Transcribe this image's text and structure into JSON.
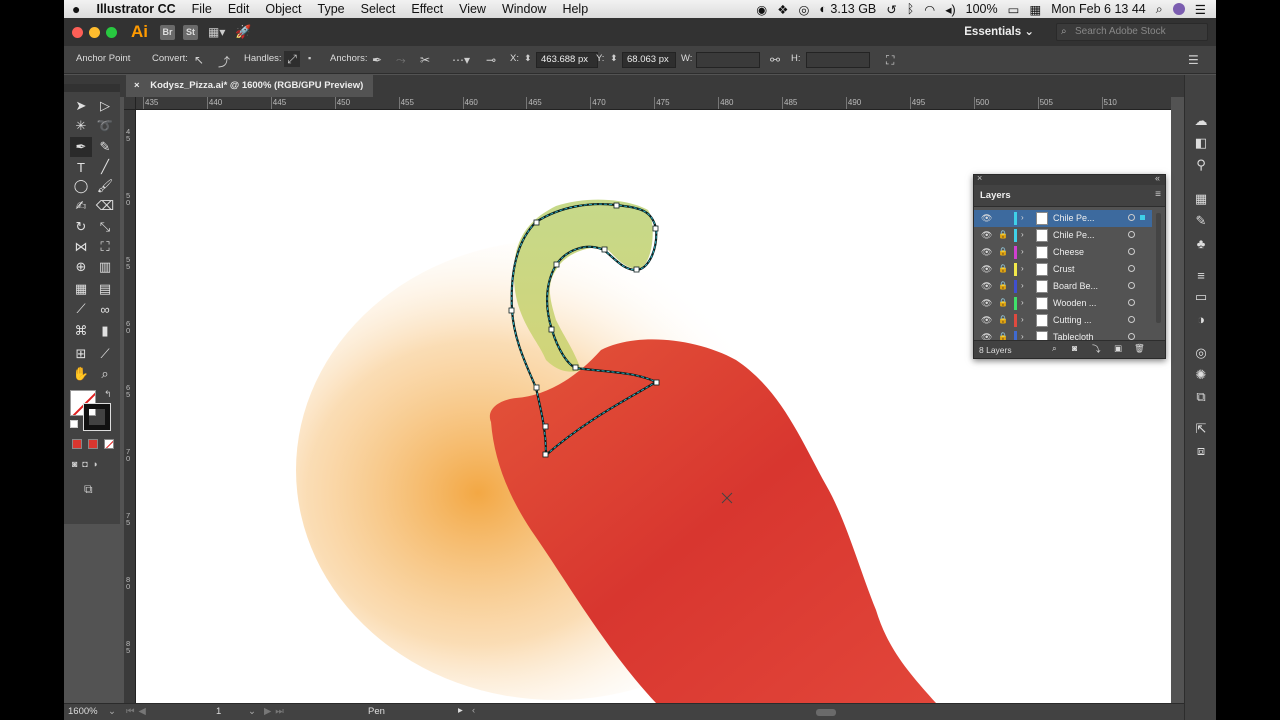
{
  "menubar": {
    "apple": "",
    "app_name": "Illustrator CC",
    "items": [
      "File",
      "Edit",
      "Object",
      "Type",
      "Select",
      "Effect",
      "View",
      "Window",
      "Help"
    ],
    "memory": "3.13 GB",
    "battery": "100%",
    "clock": "Mon Feb 6  13 44"
  },
  "titlebar": {
    "logo": "Ai",
    "bridge": "Br",
    "stock": "St",
    "workspace": "Essentials",
    "search_placeholder": "Search Adobe Stock"
  },
  "control": {
    "context_label": "Anchor Point",
    "convert_label": "Convert:",
    "handles_label": "Handles:",
    "anchors_label": "Anchors:",
    "x_label": "X:",
    "x_value": "463.688 px",
    "y_label": "Y:",
    "y_value": "68.063 px",
    "w_label": "W:",
    "h_label": "H:"
  },
  "document": {
    "tab_title": "Kodysz_Pizza.ai* @ 1600% (RGB/GPU Preview)",
    "close_glyph": "×"
  },
  "ruler": {
    "h_labels": [
      "435",
      "440",
      "445",
      "450",
      "455",
      "460",
      "465",
      "470",
      "475",
      "480",
      "485",
      "490",
      "495",
      "500",
      "505",
      "510"
    ],
    "v_labels": [
      "45",
      "50",
      "55",
      "60",
      "65",
      "70",
      "75",
      "80",
      "85"
    ]
  },
  "status": {
    "zoom": "1600%",
    "artboard": "1",
    "tool": "Pen"
  },
  "layers_panel": {
    "title": "Layers",
    "count_label": "8 Layers",
    "rows": [
      {
        "name": "Chile Pe...",
        "color": "#3fd0e8",
        "selected": true
      },
      {
        "name": "Chile Pe...",
        "color": "#3fd0e8",
        "selected": false
      },
      {
        "name": "Cheese",
        "color": "#d13fd0",
        "selected": false
      },
      {
        "name": "Crust",
        "color": "#f2e94a",
        "selected": false
      },
      {
        "name": "Board Be...",
        "color": "#3f4fd0",
        "selected": false
      },
      {
        "name": "Wooden ...",
        "color": "#3fe06a",
        "selected": false
      },
      {
        "name": "Cutting ...",
        "color": "#e04a3f",
        "selected": false
      },
      {
        "name": "Tablecloth",
        "color": "#3f6ad0",
        "selected": false
      }
    ]
  },
  "colors": {
    "pepper_red": "#d8362f",
    "pepper_highlight": "#e4553a",
    "stem_green": "#c6d98a",
    "path_selection": "#2ec4d8",
    "glow_orange": "#f2a33a"
  }
}
